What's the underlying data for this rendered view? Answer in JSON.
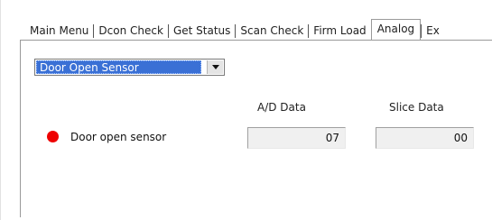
{
  "tabs": [
    {
      "label": "Main Menu"
    },
    {
      "label": "Dcon Check"
    },
    {
      "label": "Get Status"
    },
    {
      "label": "Scan Check"
    },
    {
      "label": "Firm Load"
    },
    {
      "label": "Analog"
    },
    {
      "label": "Ex"
    }
  ],
  "active_tab": "Analog",
  "sensor_select": {
    "value": "Door Open Sensor"
  },
  "columns": {
    "ad_data": "A/D Data",
    "slice_data": "Slice Data"
  },
  "sensor": {
    "label": "Door open sensor",
    "indicator_color": "#ee0000",
    "ad_value": "07",
    "slice_value": "00"
  }
}
